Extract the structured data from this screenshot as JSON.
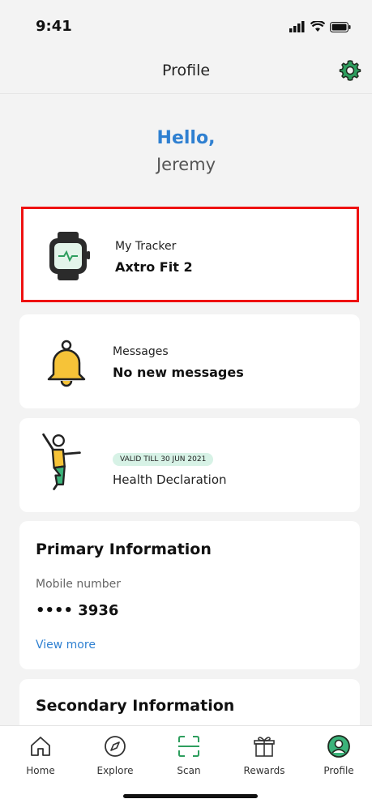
{
  "status_bar": {
    "time": "9:41"
  },
  "header": {
    "title": "Profile",
    "settings_icon": "gear-icon"
  },
  "greeting": {
    "hello": "Hello,",
    "name": "Jeremy"
  },
  "tracker_card": {
    "label": "My Tracker",
    "value": "Axtro Fit 2",
    "icon": "smartwatch-icon"
  },
  "messages_card": {
    "label": "Messages",
    "value": "No new messages",
    "icon": "bell-icon"
  },
  "health_card": {
    "badge": "VALID TILL 30 JUN 2021",
    "label": "Health Declaration",
    "icon": "person-stretching-icon"
  },
  "primary_info": {
    "title": "Primary Information",
    "field_label": "Mobile number",
    "field_value": "•••• 3936",
    "view_more": "View more"
  },
  "secondary_info": {
    "title": "Secondary Information"
  },
  "tab_bar": {
    "tabs": [
      {
        "label": "Home",
        "icon": "home-icon"
      },
      {
        "label": "Explore",
        "icon": "compass-icon"
      },
      {
        "label": "Scan",
        "icon": "scan-icon"
      },
      {
        "label": "Rewards",
        "icon": "gift-icon"
      },
      {
        "label": "Profile",
        "icon": "profile-icon",
        "active": true
      }
    ]
  },
  "colors": {
    "accent_blue": "#2f80d1",
    "accent_green": "#2e9e5e",
    "highlight_red": "#e11111"
  }
}
